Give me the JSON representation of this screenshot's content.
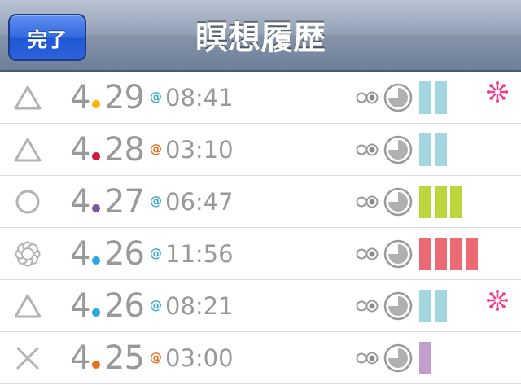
{
  "header": {
    "done_label": "完了",
    "title": "瞑想履歴"
  },
  "colors": {
    "bar_blue": "#a3d6df",
    "bar_green": "#bcd63b",
    "bar_red": "#ec6a74",
    "bar_purple": "#c39ecc",
    "at_blue": "#3bacc8",
    "at_orange": "#e8701d",
    "flag_pink": "#f0418c",
    "icon_gray": "#b3b3b3"
  },
  "rows": [
    {
      "mood": "triangle-icon",
      "month": "4",
      "day": "29",
      "dot_color": "#f4b400",
      "at_color": "#3bacc8",
      "at": "@",
      "time": "08:41",
      "bars": 2,
      "bar_color": "#a3d6df",
      "flag": true
    },
    {
      "mood": "triangle-icon",
      "month": "4",
      "day": "28",
      "dot_color": "#d9163d",
      "at_color": "#e8701d",
      "at": "@",
      "time": "03:10",
      "bars": 2,
      "bar_color": "#a3d6df",
      "flag": false
    },
    {
      "mood": "circle-icon",
      "month": "4",
      "day": "27",
      "dot_color": "#7b55a8",
      "at_color": "#3bacc8",
      "at": "@",
      "time": "06:47",
      "bars": 3,
      "bar_color": "#bcd63b",
      "flag": false
    },
    {
      "mood": "flower-icon",
      "month": "4",
      "day": "26",
      "dot_color": "#29a8df",
      "at_color": "#3bacc8",
      "at": "@",
      "time": "11:56",
      "bars": 4,
      "bar_color": "#ec6a74",
      "flag": false
    },
    {
      "mood": "triangle-icon",
      "month": "4",
      "day": "26",
      "dot_color": "#29a8df",
      "at_color": "#3bacc8",
      "at": "@",
      "time": "08:21",
      "bars": 2,
      "bar_color": "#a3d6df",
      "flag": true
    },
    {
      "mood": "cross-icon",
      "month": "4",
      "day": "25",
      "dot_color": "#e8701d",
      "at_color": "#e8701d",
      "at": "@",
      "time": "03:00",
      "bars": 1,
      "bar_color": "#c39ecc",
      "flag": false
    }
  ]
}
